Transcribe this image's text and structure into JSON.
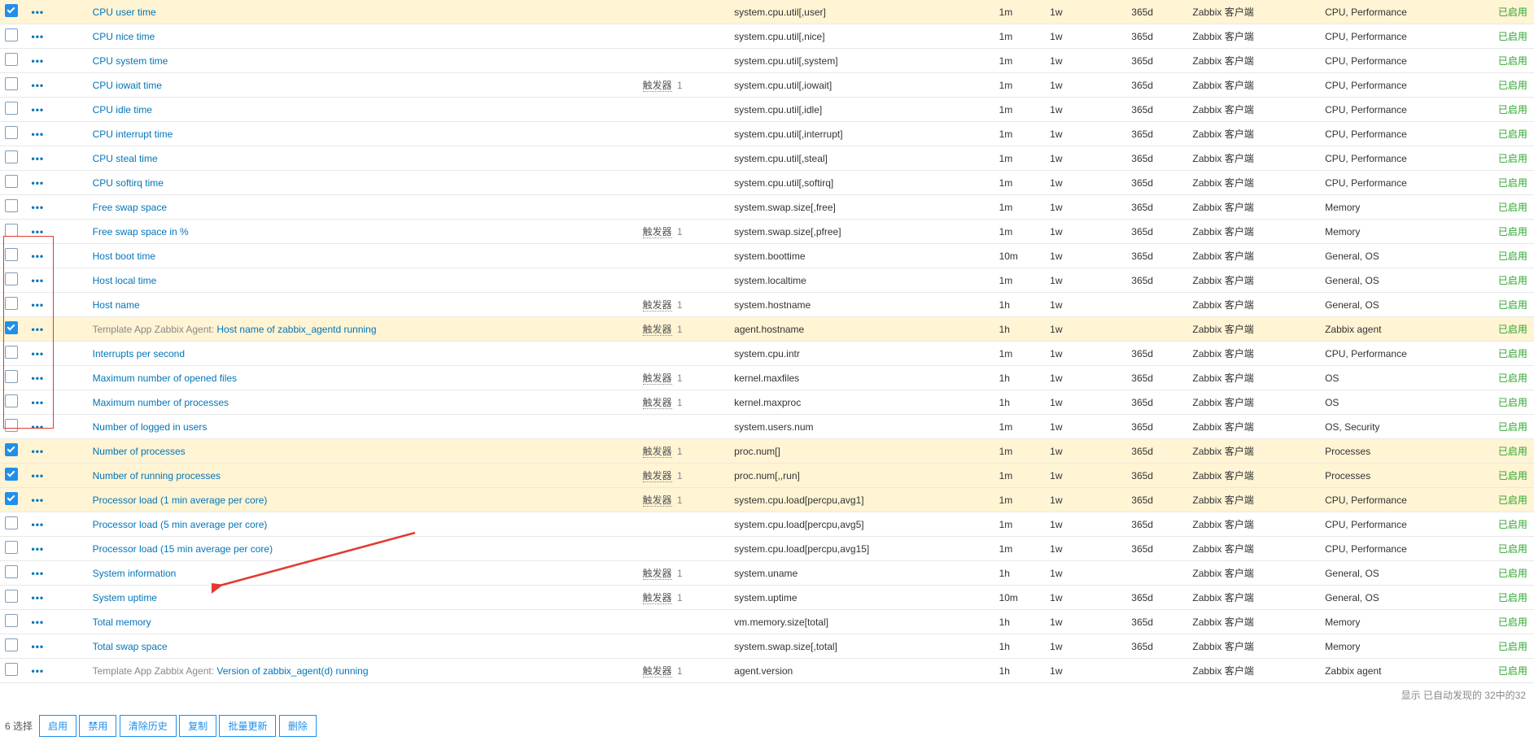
{
  "triggers_label": "触发器",
  "status_enabled": "已启用",
  "summary_text": "显示 已自动发现的 32中的32",
  "selected_label": "6 选择",
  "template_prefix": "Template App Zabbix Agent",
  "buttons": [
    "启用",
    "禁用",
    "清除历史",
    "复制",
    "批量更新",
    "删除"
  ],
  "rows": [
    {
      "chk": true,
      "name": "CPU user time",
      "key": "system.cpu.util[,user]",
      "int": "1m",
      "hist": "1w",
      "trend": "365d",
      "type": "Zabbix 客户端",
      "app": "CPU, Performance"
    },
    {
      "chk": false,
      "name": "CPU nice time",
      "key": "system.cpu.util[,nice]",
      "int": "1m",
      "hist": "1w",
      "trend": "365d",
      "type": "Zabbix 客户端",
      "app": "CPU, Performance"
    },
    {
      "chk": false,
      "name": "CPU system time",
      "key": "system.cpu.util[,system]",
      "int": "1m",
      "hist": "1w",
      "trend": "365d",
      "type": "Zabbix 客户端",
      "app": "CPU, Performance"
    },
    {
      "chk": false,
      "name": "CPU iowait time",
      "trig": 1,
      "key": "system.cpu.util[,iowait]",
      "int": "1m",
      "hist": "1w",
      "trend": "365d",
      "type": "Zabbix 客户端",
      "app": "CPU, Performance"
    },
    {
      "chk": false,
      "name": "CPU idle time",
      "key": "system.cpu.util[,idle]",
      "int": "1m",
      "hist": "1w",
      "trend": "365d",
      "type": "Zabbix 客户端",
      "app": "CPU, Performance"
    },
    {
      "chk": false,
      "name": "CPU interrupt time",
      "key": "system.cpu.util[,interrupt]",
      "int": "1m",
      "hist": "1w",
      "trend": "365d",
      "type": "Zabbix 客户端",
      "app": "CPU, Performance"
    },
    {
      "chk": false,
      "name": "CPU steal time",
      "key": "system.cpu.util[,steal]",
      "int": "1m",
      "hist": "1w",
      "trend": "365d",
      "type": "Zabbix 客户端",
      "app": "CPU, Performance"
    },
    {
      "chk": false,
      "name": "CPU softirq time",
      "key": "system.cpu.util[,softirq]",
      "int": "1m",
      "hist": "1w",
      "trend": "365d",
      "type": "Zabbix 客户端",
      "app": "CPU, Performance"
    },
    {
      "chk": false,
      "name": "Free swap space",
      "key": "system.swap.size[,free]",
      "int": "1m",
      "hist": "1w",
      "trend": "365d",
      "type": "Zabbix 客户端",
      "app": "Memory"
    },
    {
      "chk": false,
      "name": "Free swap space in %",
      "trig": 1,
      "key": "system.swap.size[,pfree]",
      "int": "1m",
      "hist": "1w",
      "trend": "365d",
      "type": "Zabbix 客户端",
      "app": "Memory"
    },
    {
      "chk": false,
      "name": "Host boot time",
      "key": "system.boottime",
      "int": "10m",
      "hist": "1w",
      "trend": "365d",
      "type": "Zabbix 客户端",
      "app": "General, OS"
    },
    {
      "chk": false,
      "name": "Host local time",
      "key": "system.localtime",
      "int": "1m",
      "hist": "1w",
      "trend": "365d",
      "type": "Zabbix 客户端",
      "app": "General, OS"
    },
    {
      "chk": false,
      "name": "Host name",
      "trig": 1,
      "key": "system.hostname",
      "int": "1h",
      "hist": "1w",
      "trend": "",
      "type": "Zabbix 客户端",
      "app": "General, OS"
    },
    {
      "chk": true,
      "tpl": true,
      "name": "Host name of zabbix_agentd running",
      "trig": 1,
      "key": "agent.hostname",
      "int": "1h",
      "hist": "1w",
      "trend": "",
      "type": "Zabbix 客户端",
      "app": "Zabbix agent"
    },
    {
      "chk": false,
      "name": "Interrupts per second",
      "key": "system.cpu.intr",
      "int": "1m",
      "hist": "1w",
      "trend": "365d",
      "type": "Zabbix 客户端",
      "app": "CPU, Performance"
    },
    {
      "chk": false,
      "name": "Maximum number of opened files",
      "trig": 1,
      "key": "kernel.maxfiles",
      "int": "1h",
      "hist": "1w",
      "trend": "365d",
      "type": "Zabbix 客户端",
      "app": "OS"
    },
    {
      "chk": false,
      "name": "Maximum number of processes",
      "trig": 1,
      "key": "kernel.maxproc",
      "int": "1h",
      "hist": "1w",
      "trend": "365d",
      "type": "Zabbix 客户端",
      "app": "OS"
    },
    {
      "chk": false,
      "name": "Number of logged in users",
      "key": "system.users.num",
      "int": "1m",
      "hist": "1w",
      "trend": "365d",
      "type": "Zabbix 客户端",
      "app": "OS, Security"
    },
    {
      "chk": true,
      "name": "Number of processes",
      "trig": 1,
      "key": "proc.num[]",
      "int": "1m",
      "hist": "1w",
      "trend": "365d",
      "type": "Zabbix 客户端",
      "app": "Processes"
    },
    {
      "chk": true,
      "name": "Number of running processes",
      "trig": 1,
      "key": "proc.num[,,run]",
      "int": "1m",
      "hist": "1w",
      "trend": "365d",
      "type": "Zabbix 客户端",
      "app": "Processes"
    },
    {
      "chk": true,
      "name": "Processor load (1 min average per core)",
      "trig": 1,
      "key": "system.cpu.load[percpu,avg1]",
      "int": "1m",
      "hist": "1w",
      "trend": "365d",
      "type": "Zabbix 客户端",
      "app": "CPU, Performance"
    },
    {
      "chk": false,
      "name": "Processor load (5 min average per core)",
      "key": "system.cpu.load[percpu,avg5]",
      "int": "1m",
      "hist": "1w",
      "trend": "365d",
      "type": "Zabbix 客户端",
      "app": "CPU, Performance"
    },
    {
      "chk": false,
      "name": "Processor load (15 min average per core)",
      "key": "system.cpu.load[percpu,avg15]",
      "int": "1m",
      "hist": "1w",
      "trend": "365d",
      "type": "Zabbix 客户端",
      "app": "CPU, Performance"
    },
    {
      "chk": false,
      "name": "System information",
      "trig": 1,
      "key": "system.uname",
      "int": "1h",
      "hist": "1w",
      "trend": "",
      "type": "Zabbix 客户端",
      "app": "General, OS"
    },
    {
      "chk": false,
      "name": "System uptime",
      "trig": 1,
      "key": "system.uptime",
      "int": "10m",
      "hist": "1w",
      "trend": "365d",
      "type": "Zabbix 客户端",
      "app": "General, OS"
    },
    {
      "chk": false,
      "name": "Total memory",
      "key": "vm.memory.size[total]",
      "int": "1h",
      "hist": "1w",
      "trend": "365d",
      "type": "Zabbix 客户端",
      "app": "Memory"
    },
    {
      "chk": false,
      "name": "Total swap space",
      "key": "system.swap.size[,total]",
      "int": "1h",
      "hist": "1w",
      "trend": "365d",
      "type": "Zabbix 客户端",
      "app": "Memory"
    },
    {
      "chk": false,
      "tpl": true,
      "name": "Version of zabbix_agent(d) running",
      "trig": 1,
      "key": "agent.version",
      "int": "1h",
      "hist": "1w",
      "trend": "",
      "type": "Zabbix 客户端",
      "app": "Zabbix agent"
    }
  ]
}
